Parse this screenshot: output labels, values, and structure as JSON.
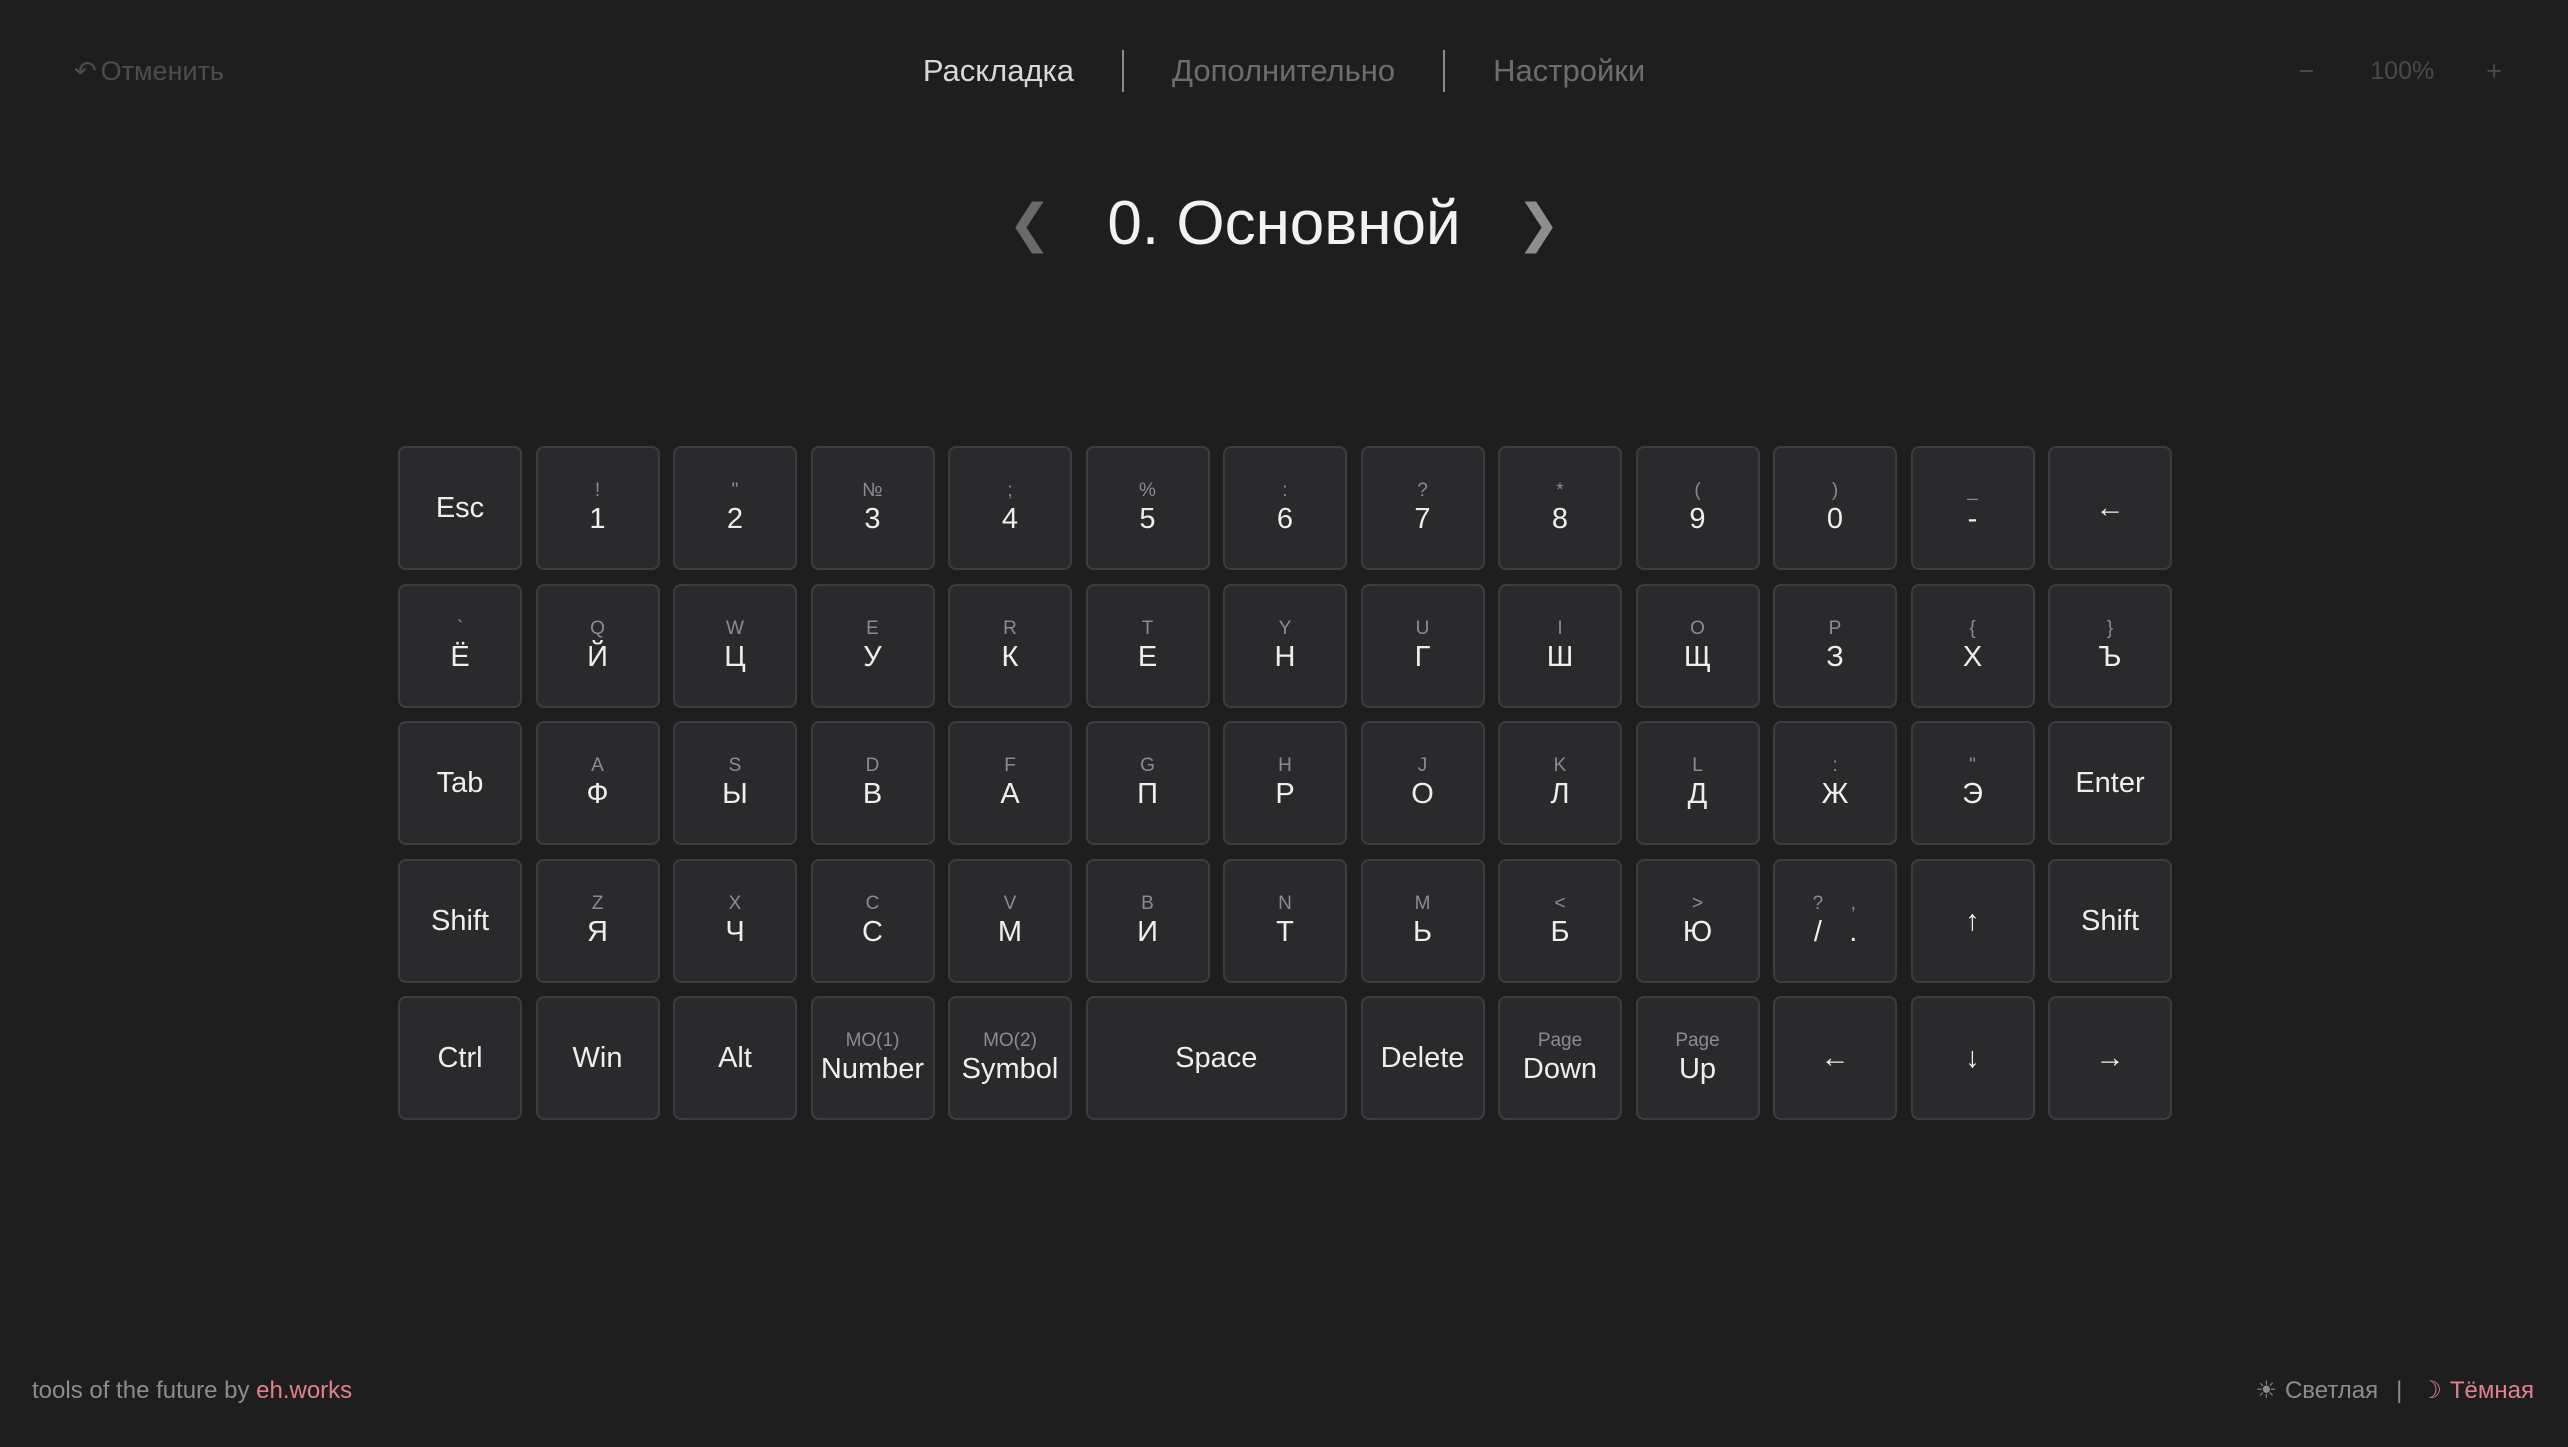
{
  "toolbar": {
    "undo_icon": "undo-arrow-icon",
    "undo_label": "Отменить",
    "tabs": [
      {
        "label": "Раскладка",
        "active": true
      },
      {
        "label": "Дополнительно",
        "active": false
      },
      {
        "label": "Настройки",
        "active": false
      }
    ],
    "zoom_minus": "−",
    "zoom_value": "100%",
    "zoom_plus": "+"
  },
  "layer": {
    "prev": "❮",
    "title": "0. Основной",
    "next": "❯"
  },
  "keyboard": {
    "rows": [
      [
        {
          "main": "Esc"
        },
        {
          "top": "!",
          "main": "1"
        },
        {
          "top": "\"",
          "main": "2"
        },
        {
          "top": "№",
          "main": "3"
        },
        {
          "top": ";",
          "main": "4"
        },
        {
          "top": "%",
          "main": "5"
        },
        {
          "top": ":",
          "main": "6"
        },
        {
          "top": "?",
          "main": "7"
        },
        {
          "top": "*",
          "main": "8"
        },
        {
          "top": "(",
          "main": "9"
        },
        {
          "top": ")",
          "main": "0"
        },
        {
          "top": "_",
          "main": "-"
        },
        {
          "main": "←",
          "arrow": true
        }
      ],
      [
        {
          "top": "`",
          "main": "Ё"
        },
        {
          "top": "Q",
          "main": "Й"
        },
        {
          "top": "W",
          "main": "Ц"
        },
        {
          "top": "E",
          "main": "У"
        },
        {
          "top": "R",
          "main": "К"
        },
        {
          "top": "T",
          "main": "Е"
        },
        {
          "top": "Y",
          "main": "Н"
        },
        {
          "top": "U",
          "main": "Г"
        },
        {
          "top": "I",
          "main": "Ш"
        },
        {
          "top": "O",
          "main": "Щ"
        },
        {
          "top": "P",
          "main": "З"
        },
        {
          "top": "{",
          "main": "Х"
        },
        {
          "top": "}",
          "main": "Ъ"
        }
      ],
      [
        {
          "main": "Tab"
        },
        {
          "top": "A",
          "main": "Ф"
        },
        {
          "top": "S",
          "main": "Ы"
        },
        {
          "top": "D",
          "main": "В"
        },
        {
          "top": "F",
          "main": "А"
        },
        {
          "top": "G",
          "main": "П"
        },
        {
          "top": "H",
          "main": "Р"
        },
        {
          "top": "J",
          "main": "О"
        },
        {
          "top": "K",
          "main": "Л"
        },
        {
          "top": "L",
          "main": "Д"
        },
        {
          "top": ":",
          "main": "Ж"
        },
        {
          "top": "\"",
          "main": "Э"
        },
        {
          "main": "Enter"
        }
      ],
      [
        {
          "main": "Shift"
        },
        {
          "top": "Z",
          "main": "Я"
        },
        {
          "top": "X",
          "main": "Ч"
        },
        {
          "top": "C",
          "main": "С"
        },
        {
          "top": "V",
          "main": "М"
        },
        {
          "top": "B",
          "main": "И"
        },
        {
          "top": "N",
          "main": "Т"
        },
        {
          "top": "M",
          "main": "Ь"
        },
        {
          "top": "<",
          "main": "Б"
        },
        {
          "top": ">",
          "main": "Ю"
        },
        {
          "split": [
            {
              "top": "?",
              "main": "/"
            },
            {
              "top": ",",
              "main": "."
            }
          ]
        },
        {
          "main": "↑",
          "arrow": true
        },
        {
          "main": "Shift"
        }
      ],
      [
        {
          "main": "Ctrl"
        },
        {
          "main": "Win"
        },
        {
          "main": "Alt"
        },
        {
          "top": "MO(1)",
          "main": "Number"
        },
        {
          "top": "MO(2)",
          "main": "Symbol"
        },
        {
          "main": "Space",
          "wide": 2
        },
        {
          "main": "Delete"
        },
        {
          "top": "Page",
          "main": "Down"
        },
        {
          "top": "Page",
          "main": "Up"
        },
        {
          "main": "←",
          "arrow": true
        },
        {
          "main": "↓",
          "arrow": true
        },
        {
          "main": "→",
          "arrow": true
        }
      ]
    ]
  },
  "footer": {
    "prefix": "tools of the future by",
    "brand": "eh.works",
    "light_icon": "sun-icon",
    "light_label": "Светлая",
    "separator": "|",
    "dark_icon": "moon-icon",
    "dark_label": "Тёмная",
    "accent_color": "#e2808c"
  }
}
